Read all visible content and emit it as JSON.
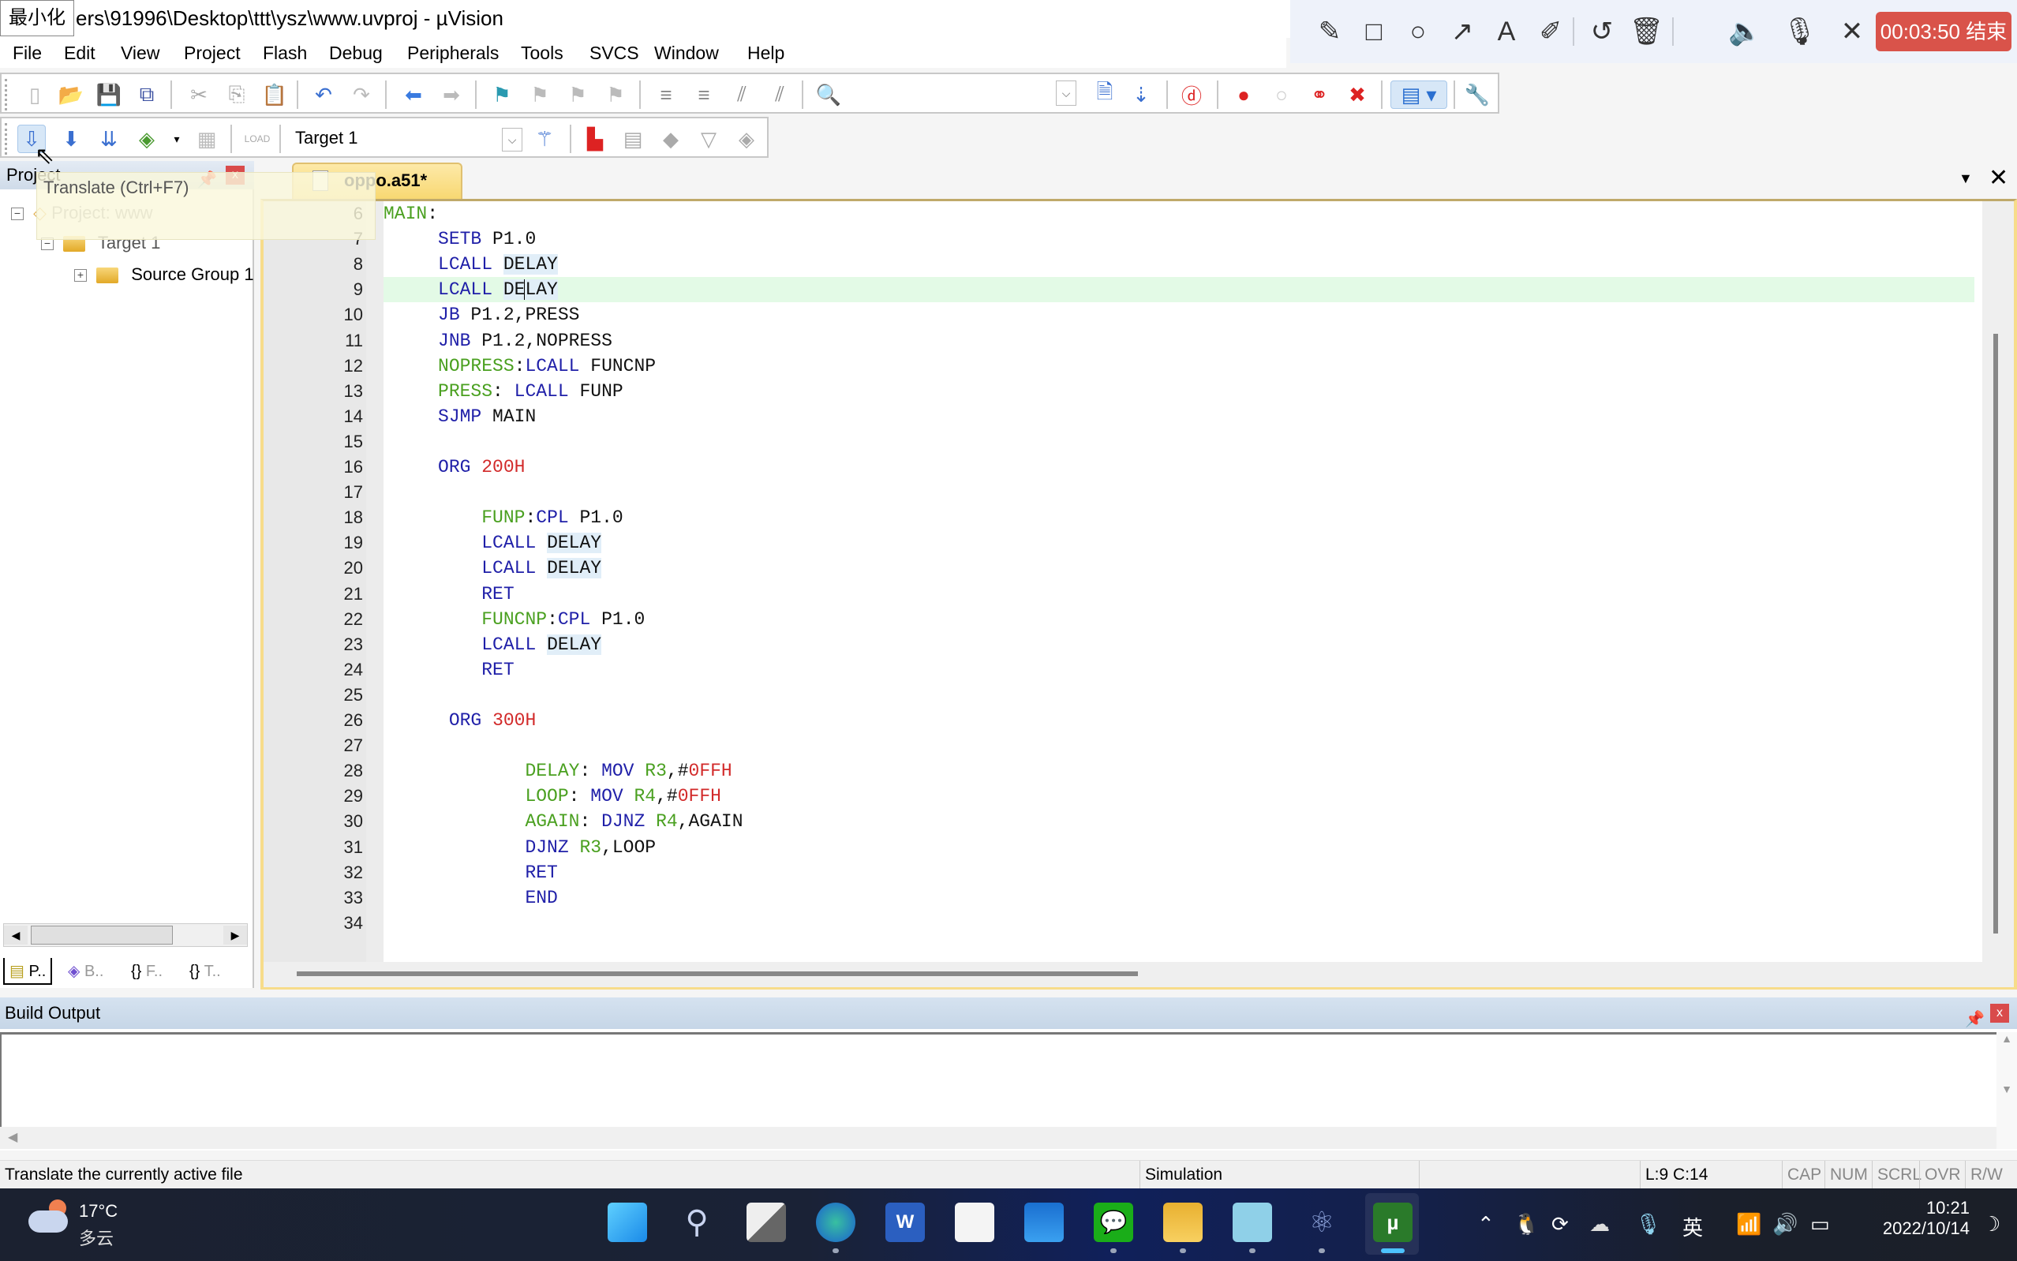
{
  "window": {
    "minimize_tooltip": "最小化",
    "title": "ers\\91996\\Desktop\\ttt\\ysz\\www.uvproj - µVision"
  },
  "recorder": {
    "tools": [
      "pencil-icon",
      "rectangle-icon",
      "circle-icon",
      "arrow-icon",
      "text-icon",
      "magic-pen-icon",
      "undo-icon",
      "trash-icon",
      "speaker-icon",
      "microphone-icon",
      "close-icon"
    ],
    "timer_label": "00:03:50 结束",
    "accent": "#d9534a"
  },
  "menu": [
    "File",
    "Edit",
    "View",
    "Project",
    "Flash",
    "Debug",
    "Peripherals",
    "Tools",
    "SVCS",
    "Window",
    "Help"
  ],
  "toolbar2": {
    "target": "Target 1"
  },
  "project_panel": {
    "title": "Project",
    "tooltip": "Translate (Ctrl+F7)",
    "tree": [
      {
        "label": "Project: www",
        "expander": "−"
      },
      {
        "label": "Target 1",
        "expander": "−"
      },
      {
        "label": "Source Group 1",
        "expander": "+"
      }
    ],
    "tabs": [
      "P..",
      "B..",
      "F..",
      "T.."
    ]
  },
  "editor": {
    "tab_label": "oppo.a51*",
    "current_line": 9,
    "lines": [
      {
        "n": "6",
        "tokens": [
          [
            "lb",
            "MAIN"
          ],
          [
            "tx",
            ":"
          ]
        ]
      },
      {
        "n": "7",
        "tokens": [
          [
            "tx",
            "     "
          ],
          [
            "kw",
            "SETB"
          ],
          [
            "tx",
            " P1.0"
          ]
        ]
      },
      {
        "n": "8",
        "tokens": [
          [
            "tx",
            "     "
          ],
          [
            "kw",
            "LCALL"
          ],
          [
            "tx",
            " "
          ],
          [
            "hl",
            "DELAY"
          ]
        ]
      },
      {
        "n": "9",
        "tokens": [
          [
            "tx",
            "     "
          ],
          [
            "kw",
            "LCALL"
          ],
          [
            "tx",
            " "
          ],
          [
            "hl",
            "DE"
          ],
          [
            "caret",
            ""
          ],
          [
            "hl",
            "LAY"
          ]
        ]
      },
      {
        "n": "10",
        "tokens": [
          [
            "tx",
            "     "
          ],
          [
            "kw",
            "JB"
          ],
          [
            "tx",
            " P1.2,PRESS"
          ]
        ]
      },
      {
        "n": "11",
        "tokens": [
          [
            "tx",
            "     "
          ],
          [
            "kw",
            "JNB"
          ],
          [
            "tx",
            " P1.2,NOPRESS"
          ]
        ]
      },
      {
        "n": "12",
        "tokens": [
          [
            "tx",
            "     "
          ],
          [
            "lb",
            "NOPRESS"
          ],
          [
            "tx",
            ":"
          ],
          [
            "kw",
            "LCALL"
          ],
          [
            "tx",
            " FUNCNP"
          ]
        ]
      },
      {
        "n": "13",
        "tokens": [
          [
            "tx",
            "     "
          ],
          [
            "lb",
            "PRESS"
          ],
          [
            "tx",
            ": "
          ],
          [
            "kw",
            "LCALL"
          ],
          [
            "tx",
            " FUNP"
          ]
        ]
      },
      {
        "n": "14",
        "tokens": [
          [
            "tx",
            "     "
          ],
          [
            "kw",
            "SJMP"
          ],
          [
            "tx",
            " MAIN"
          ]
        ]
      },
      {
        "n": "15",
        "tokens": []
      },
      {
        "n": "16",
        "tokens": [
          [
            "tx",
            "     "
          ],
          [
            "kw",
            "ORG"
          ],
          [
            "tx",
            " "
          ],
          [
            "num",
            "200H"
          ]
        ]
      },
      {
        "n": "17",
        "tokens": []
      },
      {
        "n": "18",
        "tokens": [
          [
            "tx",
            "         "
          ],
          [
            "lb",
            "FUNP"
          ],
          [
            "tx",
            ":"
          ],
          [
            "kw",
            "CPL"
          ],
          [
            "tx",
            " P1.0"
          ]
        ]
      },
      {
        "n": "19",
        "tokens": [
          [
            "tx",
            "         "
          ],
          [
            "kw",
            "LCALL"
          ],
          [
            "tx",
            " "
          ],
          [
            "hl",
            "DELAY"
          ]
        ]
      },
      {
        "n": "20",
        "tokens": [
          [
            "tx",
            "         "
          ],
          [
            "kw",
            "LCALL"
          ],
          [
            "tx",
            " "
          ],
          [
            "hl",
            "DELAY"
          ]
        ]
      },
      {
        "n": "21",
        "tokens": [
          [
            "tx",
            "         "
          ],
          [
            "kw",
            "RET"
          ]
        ]
      },
      {
        "n": "22",
        "tokens": [
          [
            "tx",
            "         "
          ],
          [
            "lb",
            "FUNCNP"
          ],
          [
            "tx",
            ":"
          ],
          [
            "kw",
            "CPL"
          ],
          [
            "tx",
            " P1.0"
          ]
        ]
      },
      {
        "n": "23",
        "tokens": [
          [
            "tx",
            "         "
          ],
          [
            "kw",
            "LCALL"
          ],
          [
            "tx",
            " "
          ],
          [
            "hl",
            "DELAY"
          ]
        ]
      },
      {
        "n": "24",
        "tokens": [
          [
            "tx",
            "         "
          ],
          [
            "kw",
            "RET"
          ]
        ]
      },
      {
        "n": "25",
        "tokens": []
      },
      {
        "n": "26",
        "tokens": [
          [
            "tx",
            "      "
          ],
          [
            "kw",
            "ORG"
          ],
          [
            "tx",
            " "
          ],
          [
            "num",
            "300H"
          ]
        ]
      },
      {
        "n": "27",
        "tokens": []
      },
      {
        "n": "28",
        "tokens": [
          [
            "tx",
            "             "
          ],
          [
            "lb",
            "DELAY"
          ],
          [
            "tx",
            ": "
          ],
          [
            "kw",
            "MOV"
          ],
          [
            "tx",
            " "
          ],
          [
            "lb",
            "R3"
          ],
          [
            "tx",
            ",#"
          ],
          [
            "num",
            "0FFH"
          ]
        ]
      },
      {
        "n": "29",
        "tokens": [
          [
            "tx",
            "             "
          ],
          [
            "lb",
            "LOOP"
          ],
          [
            "tx",
            ": "
          ],
          [
            "kw",
            "MOV"
          ],
          [
            "tx",
            " "
          ],
          [
            "lb",
            "R4"
          ],
          [
            "tx",
            ",#"
          ],
          [
            "num",
            "0FFH"
          ]
        ]
      },
      {
        "n": "30",
        "tokens": [
          [
            "tx",
            "             "
          ],
          [
            "lb",
            "AGAIN"
          ],
          [
            "tx",
            ": "
          ],
          [
            "kw",
            "DJNZ"
          ],
          [
            "tx",
            " "
          ],
          [
            "lb",
            "R4"
          ],
          [
            "tx",
            ",AGAIN"
          ]
        ]
      },
      {
        "n": "31",
        "tokens": [
          [
            "tx",
            "             "
          ],
          [
            "kw",
            "DJNZ"
          ],
          [
            "tx",
            " "
          ],
          [
            "lb",
            "R3"
          ],
          [
            "tx",
            ",LOOP"
          ]
        ]
      },
      {
        "n": "32",
        "tokens": [
          [
            "tx",
            "             "
          ],
          [
            "kw",
            "RET"
          ]
        ]
      },
      {
        "n": "33",
        "tokens": [
          [
            "tx",
            "             "
          ],
          [
            "kw",
            "END"
          ]
        ]
      },
      {
        "n": "34",
        "tokens": []
      }
    ]
  },
  "build_output": {
    "title": "Build Output",
    "content": ""
  },
  "status_bar": {
    "message": "Translate the currently active file",
    "mode": "Simulation",
    "position": "L:9 C:14",
    "indicators": [
      "CAP",
      "NUM",
      "SCRL",
      "OVR",
      "R/W"
    ]
  },
  "taskbar": {
    "weather_temp": "17°C",
    "weather_desc": "多云",
    "apps": [
      "start",
      "search",
      "task-view",
      "edge",
      "word",
      "store",
      "mail",
      "wechat",
      "file-explorer",
      "notepad",
      "atom-app",
      "keil-uvision"
    ],
    "ime": "英",
    "time": "10:21",
    "date": "2022/10/14"
  },
  "colors": {
    "keyword": "#1f1fa8",
    "label": "#4aa020",
    "number": "#d22a2a",
    "current_line": "#e3fae6",
    "tab_active": "#f8d872"
  }
}
